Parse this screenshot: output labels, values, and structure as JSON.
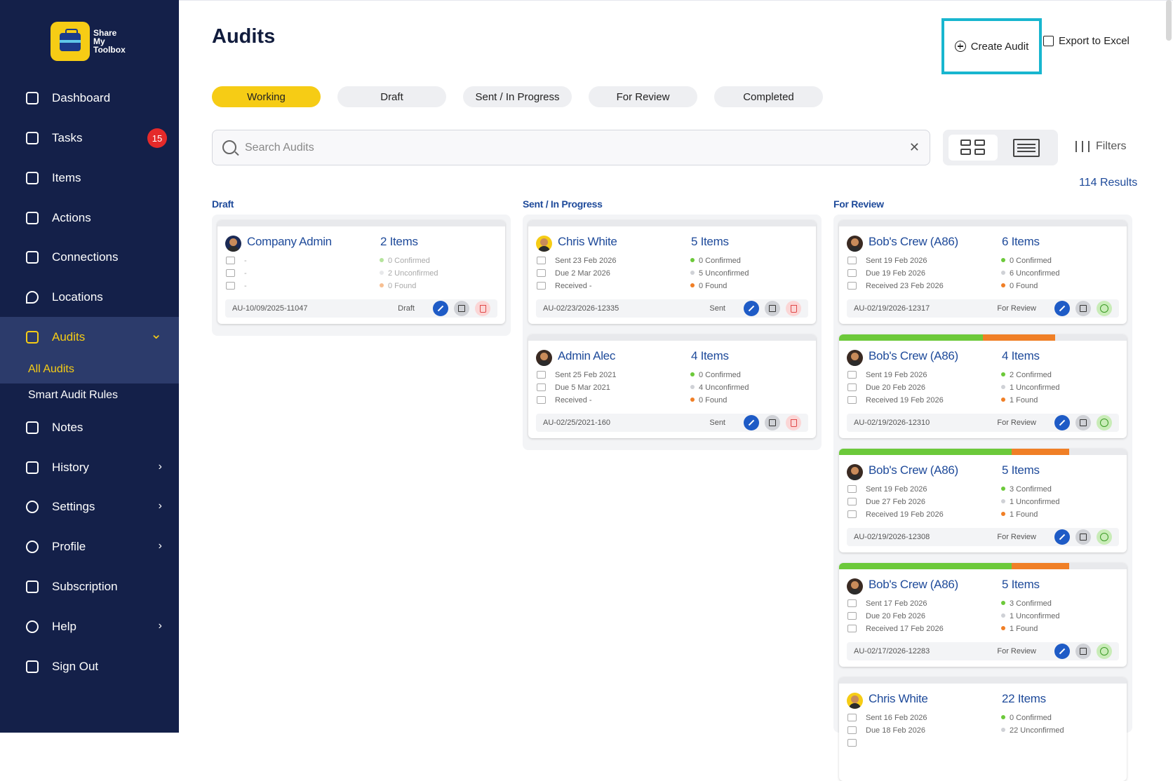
{
  "brand": {
    "name": "Share My Toolbox"
  },
  "sidebar": {
    "items": [
      {
        "label": "Dashboard",
        "icon": "grid-icon"
      },
      {
        "label": "Tasks",
        "icon": "check-square-icon",
        "badge": "15"
      },
      {
        "label": "Items",
        "icon": "toolbox-icon"
      },
      {
        "label": "Actions",
        "icon": "actions-icon"
      },
      {
        "label": "Connections",
        "icon": "people-icon"
      },
      {
        "label": "Locations",
        "icon": "pin-icon"
      },
      {
        "label": "Audits",
        "icon": "audit-icon",
        "expanded": true,
        "active": true
      },
      {
        "label": "Notes",
        "icon": "note-icon"
      },
      {
        "label": "History",
        "icon": "history-icon",
        "chevron": "›"
      },
      {
        "label": "Settings",
        "icon": "gear-icon",
        "chevron": "›"
      },
      {
        "label": "Profile",
        "icon": "user-icon",
        "chevron": "›"
      },
      {
        "label": "Subscription",
        "icon": "subscription-icon"
      },
      {
        "label": "Help",
        "icon": "help-icon",
        "chevron": "›"
      },
      {
        "label": "Sign Out",
        "icon": "sign-out-icon"
      }
    ],
    "audits_chevron": "⌄",
    "subitems": [
      {
        "label": "All Audits",
        "active": true
      },
      {
        "label": "Smart Audit Rules"
      }
    ]
  },
  "header": {
    "title": "Audits",
    "create_label": "Create Audit",
    "export_label": "Export to Excel"
  },
  "tabs": [
    "Working",
    "Draft",
    "Sent / In Progress",
    "For Review",
    "Completed"
  ],
  "search": {
    "placeholder": "Search Audits",
    "clear": "✕"
  },
  "filters_label": "Filters",
  "results_label": "114 Results",
  "columns": [
    {
      "title": "Draft",
      "cards": [
        {
          "name": "Company Admin",
          "count": "2 Items",
          "lines": [
            "-",
            "-",
            "-"
          ],
          "stats": [
            "0 Confirmed",
            "2 Unconfirmed",
            "0 Found"
          ],
          "ref": "AU-10/09/2025-11047",
          "status": "Draft",
          "action3": "delete",
          "faded": true
        }
      ]
    },
    {
      "title": "Sent / In Progress",
      "cards": [
        {
          "name": "Chris White",
          "count": "5 Items",
          "lines": [
            "Sent 23 Feb 2026",
            "Due 2 Mar 2026",
            "Received -"
          ],
          "stats": [
            "0 Confirmed",
            "5 Unconfirmed",
            "0 Found"
          ],
          "ref": "AU-02/23/2026-12335",
          "status": "Sent",
          "action3": "delete"
        },
        {
          "name": "Admin Alec",
          "count": "4 Items",
          "lines": [
            "Sent 25 Feb 2021",
            "Due 5 Mar 2021",
            "Received -"
          ],
          "stats": [
            "0 Confirmed",
            "4 Unconfirmed",
            "0 Found"
          ],
          "ref": "AU-02/25/2021-160",
          "status": "Sent",
          "action3": "delete"
        }
      ]
    },
    {
      "title": "For Review",
      "cards": [
        {
          "name": "Bob's Crew (A86)",
          "count": "6 Items",
          "lines": [
            "Sent 19 Feb 2026",
            "Due 19 Feb 2026",
            "Received 23 Feb 2026"
          ],
          "stats": [
            "0 Confirmed",
            "6 Unconfirmed",
            "0 Found"
          ],
          "ref": "AU-02/19/2026-12317",
          "status": "For Review",
          "action3": "approve",
          "progress": {
            "confirmed": 0,
            "found": 0
          }
        },
        {
          "name": "Bob's Crew (A86)",
          "count": "4 Items",
          "lines": [
            "Sent 19 Feb 2026",
            "Due 20 Feb 2026",
            "Received 19 Feb 2026"
          ],
          "stats": [
            "2 Confirmed",
            "1 Unconfirmed",
            "1 Found"
          ],
          "ref": "AU-02/19/2026-12310",
          "status": "For Review",
          "action3": "approve",
          "progress": {
            "confirmed": 0.5,
            "found": 0.25
          }
        },
        {
          "name": "Bob's Crew (A86)",
          "count": "5 Items",
          "lines": [
            "Sent 19 Feb 2026",
            "Due 27 Feb 2026",
            "Received 19 Feb 2026"
          ],
          "stats": [
            "3 Confirmed",
            "1 Unconfirmed",
            "1 Found"
          ],
          "ref": "AU-02/19/2026-12308",
          "status": "For Review",
          "action3": "approve",
          "progress": {
            "confirmed": 0.6,
            "found": 0.2
          }
        },
        {
          "name": "Bob's Crew (A86)",
          "count": "5 Items",
          "lines": [
            "Sent 17 Feb 2026",
            "Due 20 Feb 2026",
            "Received 17 Feb 2026"
          ],
          "stats": [
            "3 Confirmed",
            "1 Unconfirmed",
            "1 Found"
          ],
          "ref": "AU-02/17/2026-12283",
          "status": "For Review",
          "action3": "approve",
          "progress": {
            "confirmed": 0.6,
            "found": 0.2
          }
        },
        {
          "name": "Chris White",
          "count": "22 Items",
          "lines": [
            "Sent 16 Feb 2026",
            "Due 18 Feb 2026",
            ""
          ],
          "stats": [
            "0 Confirmed",
            "22 Unconfirmed",
            ""
          ],
          "ref": "",
          "status": "",
          "action3": "approve"
        }
      ]
    }
  ],
  "colors": {
    "sidebar": "#142049",
    "accent": "#f6cc15",
    "link": "#1e4a9a",
    "highlight": "#18b6cf",
    "confirmed": "#6cc93a",
    "unconfirmed": "#cfd1d6",
    "found": "#f07f26"
  }
}
